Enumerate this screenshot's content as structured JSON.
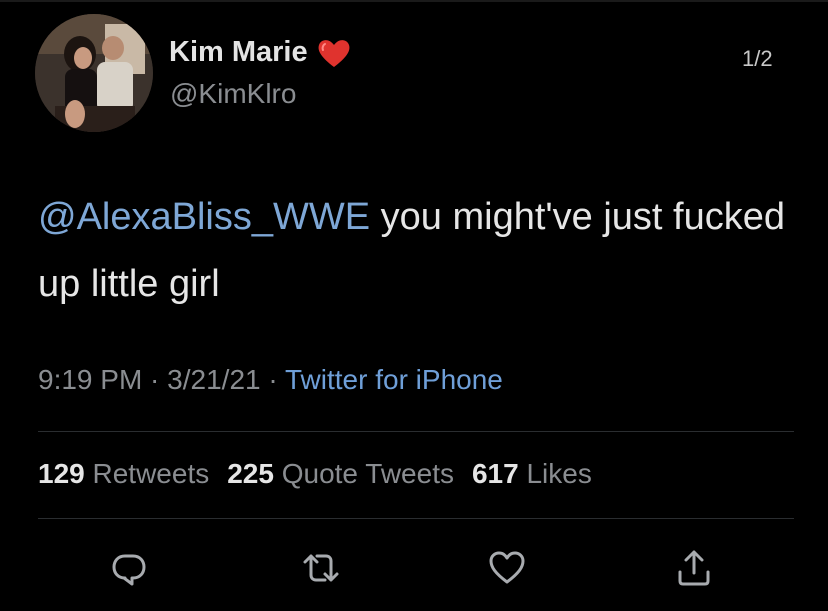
{
  "tweet": {
    "author": {
      "display_name": "Kim Marie",
      "handle": "@KimKlro",
      "badge_icon": "heart-icon",
      "badge_color": "#e0332e"
    },
    "page_counter": "1/2",
    "mention": "@AlexaBliss_WWE",
    "text": "you might've just fucked up little girl",
    "time": "9:19 PM",
    "sep1": " · ",
    "date": "3/21/21",
    "sep2": " · ",
    "source": "Twitter for iPhone",
    "stats": {
      "retweets_count": "129",
      "retweets_label": "Retweets",
      "quote_count": "225",
      "quote_label": "Quote Tweets",
      "likes_count": "617",
      "likes_label": "Likes"
    },
    "actions": [
      "reply-icon",
      "retweet-icon",
      "like-icon",
      "share-icon"
    ]
  },
  "colors": {
    "background": "#000000",
    "link": "#7ea7d6",
    "muted": "#8a8d91"
  }
}
